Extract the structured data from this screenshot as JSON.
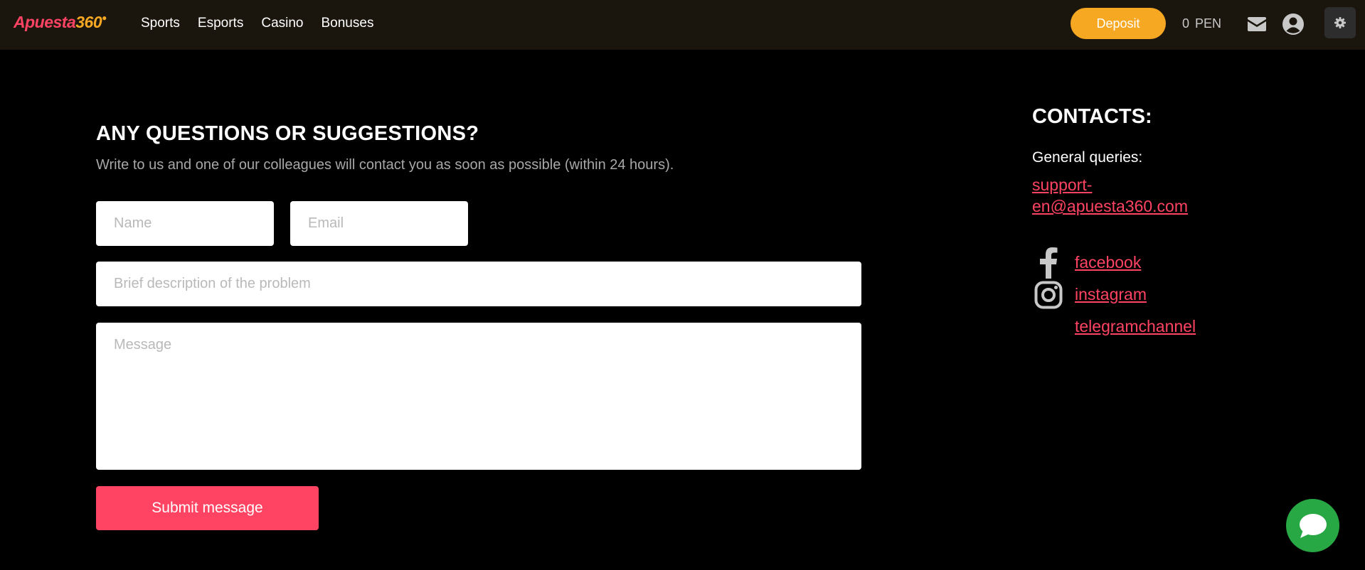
{
  "header": {
    "logo_part1": "Apuesta",
    "logo_part2": "360",
    "nav": [
      "Sports",
      "Esports",
      "Casino",
      "Bonuses"
    ],
    "deposit_label": "Deposit",
    "balance_amount": "0",
    "balance_currency": "PEN",
    "icons": [
      "mail-icon",
      "user-icon",
      "gear-icon"
    ]
  },
  "form": {
    "title": "ANY QUESTIONS OR SUGGESTIONS?",
    "subtitle": "Write to us and one of our colleagues will contact you as soon as possible (within 24 hours).",
    "name_placeholder": "Name",
    "email_placeholder": "Email",
    "description_placeholder": "Brief description of the problem",
    "message_placeholder": "Message",
    "submit_label": "Submit message"
  },
  "contacts": {
    "title": "CONTACTS:",
    "queries_label": "General queries:",
    "support_email": "support-en@apuesta360.com",
    "social": [
      {
        "label": "facebook",
        "icon": "facebook-icon"
      },
      {
        "label": "instagram",
        "icon": "instagram-icon"
      },
      {
        "label": "telegramchannel",
        "icon": ""
      }
    ]
  },
  "chat": {
    "icon": "chat-icon"
  },
  "colors": {
    "accent": "#ff4363",
    "deposit": "#f7a823",
    "chat": "#27a844",
    "header_bg": "#1a160e"
  }
}
